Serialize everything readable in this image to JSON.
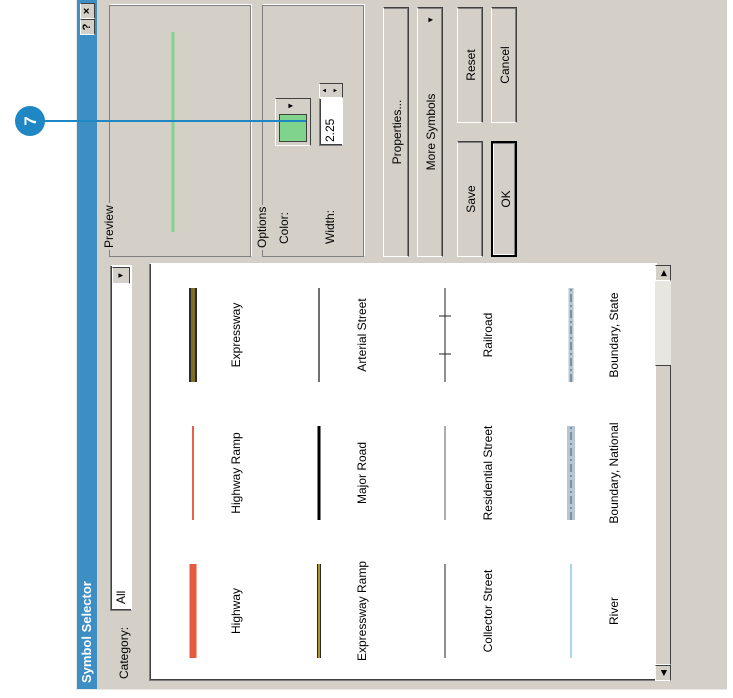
{
  "dialog": {
    "title": "Symbol Selector",
    "help_glyph": "?",
    "close_glyph": "×"
  },
  "category": {
    "label": "Category:",
    "value": "All"
  },
  "symbols": [
    {
      "name": "Highway"
    },
    {
      "name": "Highway Ramp"
    },
    {
      "name": "Expressway"
    },
    {
      "name": "Expressway Ramp"
    },
    {
      "name": "Major Road"
    },
    {
      "name": "Arterial Street"
    },
    {
      "name": "Collector Street"
    },
    {
      "name": "Residential Street"
    },
    {
      "name": "Railroad"
    },
    {
      "name": "River"
    },
    {
      "name": "Boundary, National"
    },
    {
      "name": "Boundary, State"
    },
    {
      "name": ""
    },
    {
      "name": ""
    },
    {
      "name": ""
    }
  ],
  "preview": {
    "label": "Preview",
    "line_color": "#7fd38a"
  },
  "options": {
    "label": "Options",
    "color_label": "Color:",
    "color_value": "#7fd38a",
    "width_label": "Width:",
    "width_value": "2.25"
  },
  "buttons": {
    "properties": "Properties...",
    "more_symbols": "More Symbols",
    "save": "Save",
    "reset": "Reset",
    "ok": "OK",
    "cancel": "Cancel"
  },
  "callout": {
    "number": "7",
    "color": "#1f88c4"
  }
}
